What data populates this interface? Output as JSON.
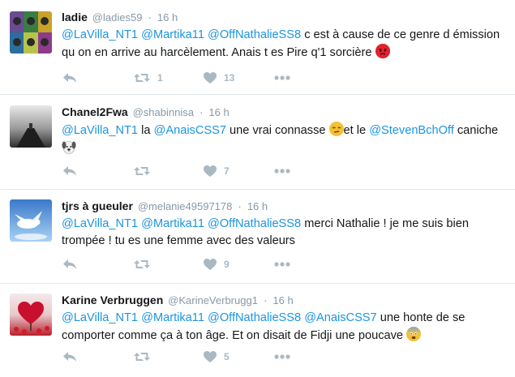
{
  "tweets": [
    {
      "name": "ladie",
      "handle": "@ladies59",
      "time": "16 h",
      "segments": [
        {
          "t": "@LaVilla_NT1",
          "m": true
        },
        {
          "t": " "
        },
        {
          "t": "@Martika11",
          "m": true
        },
        {
          "t": " "
        },
        {
          "t": "@OffNathalieSS8",
          "m": true
        },
        {
          "t": "  c est à cause de ce genre d émission qu on en arrive au harcèlement. Anais t es Pire q'1 sorcière "
        }
      ],
      "emoji": "angry-face",
      "retweets": "1",
      "likes": "13"
    },
    {
      "name": "Chanel2Fwa",
      "handle": "@shabinnisa",
      "time": "16 h",
      "segments": [
        {
          "t": "@LaVilla_NT1",
          "m": true
        },
        {
          "t": " la "
        },
        {
          "t": "@AnaisCSS7",
          "m": true
        },
        {
          "t": " une vrai connasse "
        },
        {
          "e": "unamused-face"
        },
        {
          "t": "et le "
        },
        {
          "t": "@StevenBchOff",
          "m": true
        },
        {
          "t": " caniche "
        },
        {
          "e": "dog-face"
        }
      ],
      "retweets": "",
      "likes": "7"
    },
    {
      "name": "tjrs à gueuler",
      "handle": "@melanie49597178",
      "time": "16 h",
      "segments": [
        {
          "t": "@LaVilla_NT1",
          "m": true
        },
        {
          "t": " "
        },
        {
          "t": "@Martika11",
          "m": true
        },
        {
          "t": " "
        },
        {
          "t": "@OffNathalieSS8",
          "m": true
        },
        {
          "t": " merci Nathalie ! je me suis bien trompée ! tu es une femme avec des valeurs"
        }
      ],
      "retweets": "",
      "likes": "9"
    },
    {
      "name": "Karine Verbruggen",
      "handle": "@KarineVerbrugg1",
      "time": "16 h",
      "segments": [
        {
          "t": "@LaVilla_NT1",
          "m": true
        },
        {
          "t": " "
        },
        {
          "t": "@Martika11",
          "m": true
        },
        {
          "t": " "
        },
        {
          "t": "@OffNathalieSS8",
          "m": true
        },
        {
          "t": " "
        },
        {
          "t": "@AnaisCSS7",
          "m": true
        },
        {
          "t": " une honte de se comporter comme ça à ton âge. Et on disait de Fidji une poucave "
        },
        {
          "e": "fearful-face"
        }
      ],
      "retweets": "",
      "likes": "5"
    }
  ],
  "separator": "·",
  "colors": {
    "mention": "#1b95e0",
    "muted": "#8899a6",
    "action": "#aab8c2",
    "border": "#e1e8ed"
  }
}
